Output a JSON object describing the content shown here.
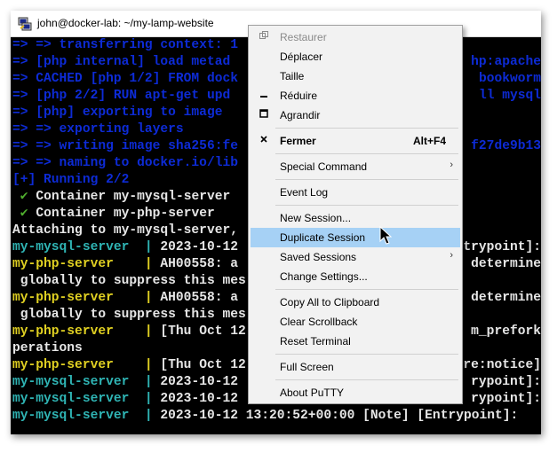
{
  "window": {
    "title": "john@docker-lab: ~/my-lamp-website",
    "app_icon": "putty-icon"
  },
  "terminal": {
    "lines": [
      {
        "text": "=> => transferring context: 1",
        "color": "blue"
      },
      {
        "text": "=> [php internal] load metad",
        "color": "blue",
        "tail": "hp:apache"
      },
      {
        "text": "=> CACHED [php 1/2] FROM dock",
        "color": "blue",
        "tail": "bookworm"
      },
      {
        "text": "=> [php 2/2] RUN apt-get upd",
        "color": "blue",
        "tail": "ll mysql"
      },
      {
        "text": "=> [php] exporting to image",
        "color": "blue"
      },
      {
        "text": "=> => exporting layers",
        "color": "blue"
      },
      {
        "text": "=> => writing image sha256:fe",
        "color": "blue",
        "tail": "f27de9b13"
      },
      {
        "text": "=> => naming to docker.io/lib",
        "color": "blue"
      },
      {
        "text": "[+] Running 2/2",
        "color": "blue"
      },
      {
        "text": " ✔ Container my-mysql-server",
        "color": "white"
      },
      {
        "text": " ✔ Container my-php-server",
        "color": "white"
      },
      {
        "text": "Attaching to my-mysql-server,",
        "color": "white"
      },
      {
        "text": "my-mysql-server  | 2023-10-12",
        "color": "white",
        "tail": "ntrypoint]:"
      },
      {
        "text": "my-php-server    | AH00558: a",
        "color": "white",
        "tail": "determine"
      },
      {
        "text": " globally to suppress this mes",
        "color": "white"
      },
      {
        "text": "my-php-server    | AH00558: a",
        "color": "white",
        "tail": "determine"
      },
      {
        "text": " globally to suppress this mes",
        "color": "white"
      },
      {
        "text": "my-php-server    | [Thu Oct 12",
        "color": "white",
        "tail": "m_prefork"
      },
      {
        "text": "perations",
        "color": "white"
      },
      {
        "text": "my-php-server    | [Thu Oct 12",
        "color": "white",
        "tail": "re:notice]"
      },
      {
        "text": "my-mysql-server  | 2023-10-12",
        "color": "white",
        "tail": "rypoint]:"
      },
      {
        "text": "my-mysql-server  | 2023-10-12",
        "color": "white",
        "tail": "rypoint]:"
      },
      {
        "text": "my-mysql-server  | 2023-10-12 13:20:52+00:00 [Note] [Entrypoint]:",
        "color": "white"
      }
    ]
  },
  "menu": {
    "items": [
      {
        "label": "Restaurer",
        "icon": "restore-icon",
        "disabled": true
      },
      {
        "label": "Déplacer"
      },
      {
        "label": "Taille"
      },
      {
        "label": "Réduire",
        "icon": "minimize-icon"
      },
      {
        "label": "Agrandir",
        "icon": "maximize-icon"
      },
      {
        "separator": true
      },
      {
        "label": "Fermer",
        "icon": "close-icon",
        "bold": true,
        "accel": "Alt+F4"
      },
      {
        "separator": true
      },
      {
        "label": "Special Command",
        "submenu": true
      },
      {
        "separator": true
      },
      {
        "label": "Event Log"
      },
      {
        "separator": true
      },
      {
        "label": "New Session..."
      },
      {
        "label": "Duplicate Session",
        "highlighted": true
      },
      {
        "label": "Saved Sessions",
        "submenu": true
      },
      {
        "label": "Change Settings..."
      },
      {
        "separator": true
      },
      {
        "label": "Copy All to Clipboard"
      },
      {
        "label": "Clear Scrollback"
      },
      {
        "label": "Reset Terminal"
      },
      {
        "separator": true
      },
      {
        "label": "Full Screen"
      },
      {
        "separator": true
      },
      {
        "label": "About PuTTY"
      }
    ]
  },
  "colors": {
    "terminal_bg": "#000000",
    "blue": "#0d2bd6",
    "green": "#4fae2e",
    "yellow": "#e0d022",
    "cyan": "#2fb4b4",
    "white": "#e6e6e6",
    "menu_bg": "#f2f2f2",
    "menu_highlight": "#a6d1f5"
  }
}
